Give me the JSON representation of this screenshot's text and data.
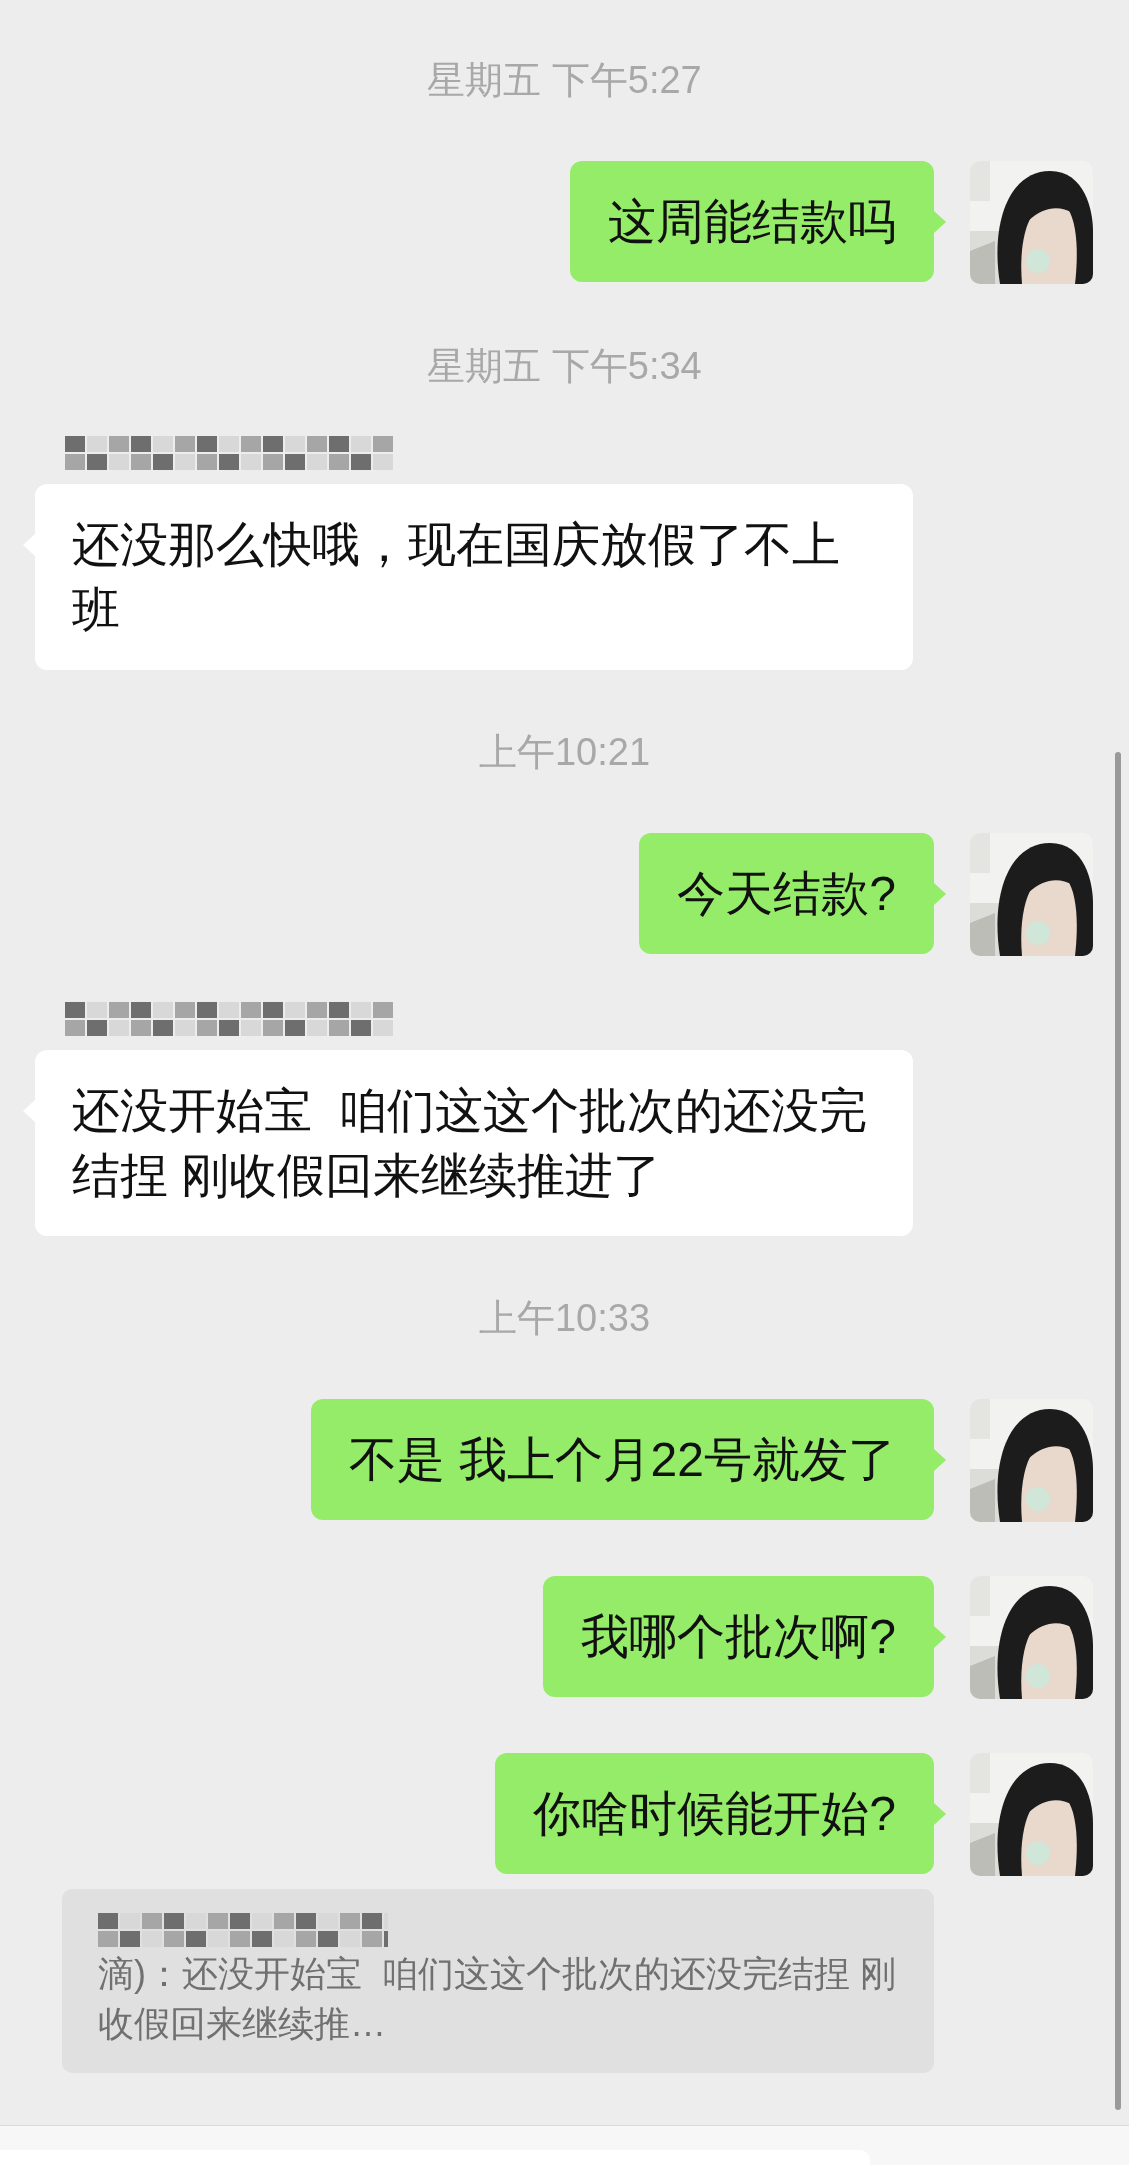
{
  "messages": [
    {
      "kind": "time",
      "text": "星期五 下午5:27"
    },
    {
      "kind": "sent",
      "text": "这周能结款吗"
    },
    {
      "kind": "time",
      "text": "星期五 下午5:34"
    },
    {
      "kind": "received",
      "text": "还没那么快哦，现在国庆放假了不上班"
    },
    {
      "kind": "time",
      "text": "上午10:21"
    },
    {
      "kind": "sent",
      "text": "今天结款?"
    },
    {
      "kind": "received",
      "text": "还没开始宝  咱们这这个批次的还没完结捏 刚收假回来继续推进了"
    },
    {
      "kind": "time",
      "text": "上午10:33"
    },
    {
      "kind": "sent",
      "text": "不是 我上个月22号就发了"
    },
    {
      "kind": "sent",
      "text": "我哪个批次啊?"
    },
    {
      "kind": "sent",
      "text": "你啥时候能开始?"
    }
  ],
  "quote": {
    "text": "滴)：还没开始宝  咱们这这个批次的还没完结捏 刚收假回来继续推…"
  }
}
